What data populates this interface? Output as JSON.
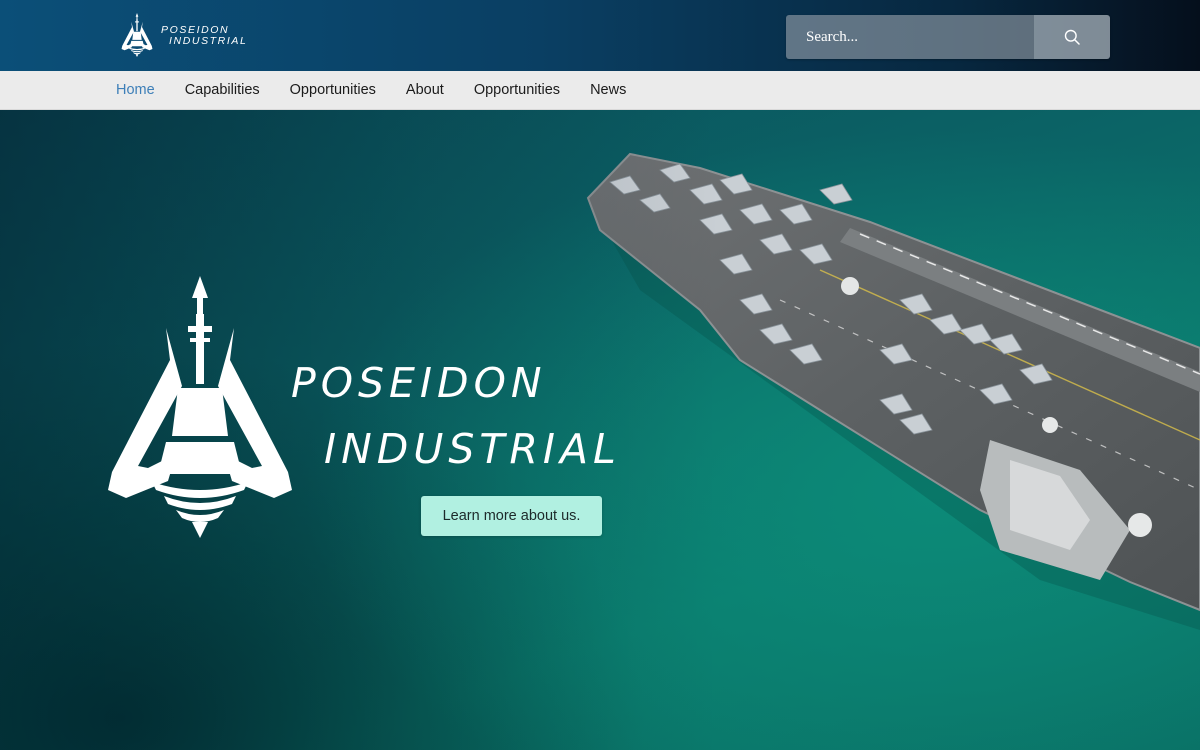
{
  "brand": {
    "line1": "POSEIDON",
    "line2": "INDUSTRIAL",
    "logo_icon": "trident-ship-logo-icon"
  },
  "search": {
    "placeholder": "Search...",
    "icon": "search-icon"
  },
  "nav": {
    "items": [
      {
        "label": "Home",
        "active": true
      },
      {
        "label": "Capabilities"
      },
      {
        "label": "Opportunities"
      },
      {
        "label": "About"
      },
      {
        "label": "Opportunities"
      },
      {
        "label": "News"
      }
    ],
    "active_color": "#3d7fb8"
  },
  "hero": {
    "title_line1": "POSEIDON",
    "title_line2": "INDUSTRIAL",
    "cta_label": "Learn more about us.",
    "background_image": "aircraft-carrier-aerial-photo",
    "cta_color": "#b1f0e1"
  },
  "colors": {
    "header_gradient_start": "#0b4f78",
    "header_gradient_end": "#050f1c",
    "nav_background": "#ebebeb",
    "sea": "#0a7a6c"
  }
}
